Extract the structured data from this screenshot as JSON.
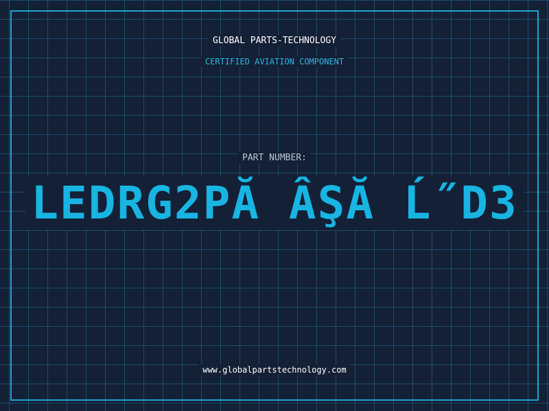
{
  "label": {
    "brand": "GLOBAL PARTS-TECHNOLOGY",
    "subtitle": "CERTIFIED AVIATION COMPONENT",
    "part_number_label": "PART NUMBER:",
    "part_number": "LEDRG2PĂ ÂŞĂ Ĺ˝D3",
    "website": "www.globalpartstechnology.com"
  },
  "colors": {
    "background": "#142036",
    "grid": "#2896be",
    "frame": "#1fa6cf",
    "accent": "#18b4e2",
    "muted_text": "#b9c6d4",
    "text": "#ffffff"
  }
}
